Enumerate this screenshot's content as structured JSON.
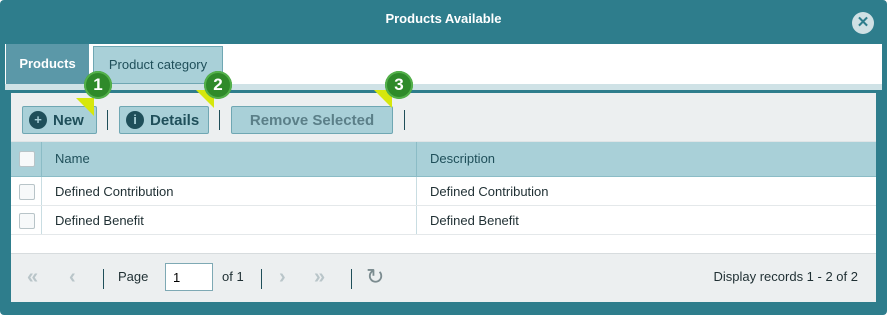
{
  "window": {
    "title": "Products Available",
    "close_icon": "close-icon"
  },
  "tabs": [
    {
      "label": "Products",
      "active": true
    },
    {
      "label": "Product category",
      "active": false
    }
  ],
  "toolbar": {
    "new_label": "New",
    "details_label": "Details",
    "remove_label": "Remove Selected"
  },
  "grid": {
    "columns": [
      "Name",
      "Description"
    ],
    "rows": [
      {
        "name": "Defined Contribution",
        "description": "Defined Contribution"
      },
      {
        "name": "Defined Benefit",
        "description": "Defined Benefit"
      }
    ]
  },
  "pager": {
    "page_label": "Page",
    "page_value": "1",
    "of_label": "of 1",
    "summary": "Display records 1 - 2 of 2"
  },
  "callouts": [
    "1",
    "2",
    "3"
  ],
  "colors": {
    "header": "#2e7d8c",
    "accent_button": "#a9d0d8",
    "callout_green": "#2f8a2a",
    "callout_pointer": "#d6e70c"
  }
}
